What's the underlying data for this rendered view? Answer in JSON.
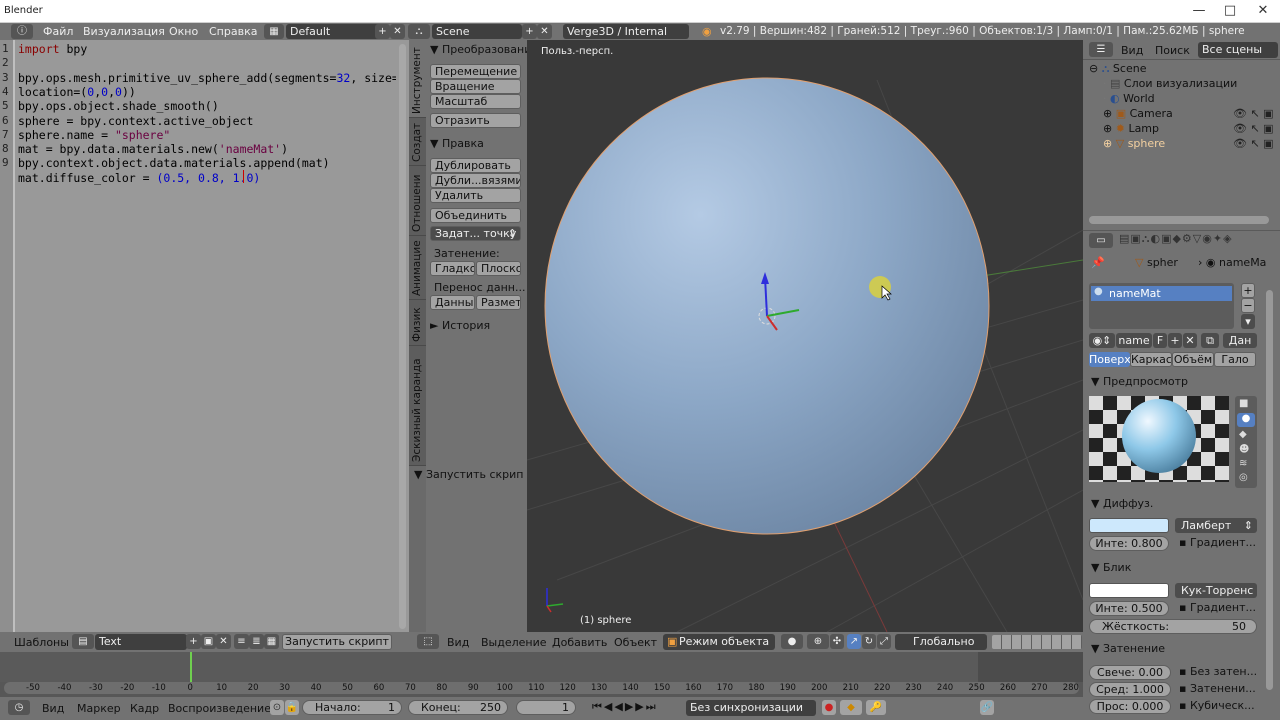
{
  "window": {
    "title": "Blender",
    "controls": [
      "—",
      "□",
      "✕"
    ]
  },
  "info": {
    "menus": [
      "Файл",
      "Визуализация",
      "Окно",
      "Справка"
    ],
    "layout": "Default",
    "scene": "Scene",
    "engine": "Verge3D / Internal",
    "stats": "v2.79 | Вершин:482 | Граней:512 | Треуг.:960 | Объектов:1/3 | Ламп:0/1 | Пам.:25.62МБ | sphere"
  },
  "code": {
    "line_numbers": [
      "1",
      "2",
      "3",
      "4",
      "5",
      "6",
      "7",
      "8",
      "9"
    ],
    "lines": [
      {
        "parts": [
          [
            "kw",
            "import"
          ],
          [
            "t",
            " bpy"
          ]
        ]
      },
      {
        "parts": []
      },
      {
        "parts": [
          [
            "t",
            "bpy.ops.mesh.primitive_uv_sphere_add(segments="
          ],
          [
            "num",
            "32"
          ],
          [
            "t",
            ", size="
          ],
          [
            "num",
            "2"
          ],
          [
            "t",
            ","
          ]
        ]
      },
      {
        "parts": [
          [
            "t",
            "location=("
          ],
          [
            "num",
            "0"
          ],
          [
            "t",
            ","
          ],
          [
            "num",
            "0"
          ],
          [
            "t",
            ","
          ],
          [
            "num",
            "0"
          ],
          [
            "t",
            "))"
          ]
        ]
      },
      {
        "parts": [
          [
            "t",
            "bpy.ops.object.shade_smooth()"
          ]
        ]
      },
      {
        "parts": [
          [
            "t",
            "sphere = bpy.context.active_object"
          ]
        ]
      },
      {
        "parts": [
          [
            "t",
            "sphere.name = "
          ],
          [
            "str",
            "\"sphere\""
          ]
        ]
      },
      {
        "parts": [
          [
            "t",
            "mat = bpy.data.materials.new("
          ],
          [
            "str",
            "'nameMat'"
          ],
          [
            "t",
            ")"
          ]
        ]
      },
      {
        "parts": [
          [
            "t",
            "bpy.context.object.data.materials.append(mat)"
          ]
        ]
      },
      {
        "parts": [
          [
            "t",
            "mat.diffuse_color = "
          ],
          [
            "num",
            "(0.5, 0.8, 1.0)"
          ]
        ]
      }
    ]
  },
  "tool_tabs": [
    "Инструмент",
    "Создат",
    "Отношени",
    "Анимацие",
    "Физик",
    "Эскизный каранда"
  ],
  "toolshelf": {
    "transform_header": "Преобразование",
    "transform_buttons": [
      "Перемещение",
      "Вращение",
      "Масштаб"
    ],
    "mirror": "Отразить",
    "edit_header": "Правка",
    "edit_buttons": [
      "Дублировать",
      "Дубли...вязями",
      "Удалить"
    ],
    "join": "Объединить",
    "origin": "Задат... точку",
    "shading_label": "Затенение:",
    "shading_buttons": [
      "Гладко",
      "Плоско"
    ],
    "data_transfer_label": "Перенос данн...",
    "data_buttons": [
      "Данны",
      "Размет"
    ],
    "history": "История",
    "run_script": "Запустить скрип"
  },
  "viewport": {
    "view_label": "Польз.-персп.",
    "object_label": "(1) sphere",
    "sphere_color": "#8ba8c8"
  },
  "outliner": {
    "menus": [
      "Вид",
      "Поиск"
    ],
    "filter": "Все сцены",
    "items": [
      "Scene",
      "Слои визуализации",
      "World",
      "Camera",
      "Lamp",
      "sphere"
    ]
  },
  "properties": {
    "breadcrumb": [
      "spher",
      "nameMa"
    ],
    "material_slot": "nameMat",
    "material_name": "name",
    "material_f": "F",
    "data_dropdown": "Дан",
    "tabs": [
      "Поверх",
      "Каркас",
      "Объём",
      "Гало"
    ],
    "preview_header": "Предпросмотр",
    "diffuse_header": "Диффуз.",
    "diffuse_color": "#cde8fc",
    "diffuse_shader": "Ламберт",
    "diffuse_intensity": "Инте: 0.800",
    "gradient": "Градиент...",
    "specular_header": "Блик",
    "specular_shader": "Кук-Торренс",
    "specular_intensity": "Инте: 0.500",
    "hardness_label": "Жёсткость:",
    "hardness_value": "50",
    "shading_header": "Затенение",
    "emit": "Свече: 0.00",
    "ambient": "Сред: 1.000",
    "translucency": "Прос: 0.000",
    "shadeless": "Без затен...",
    "tangent": "Затенени...",
    "cubic": "Кубическ..."
  },
  "text_header": {
    "templates": "Шаблоны",
    "textname": "Text",
    "run": "Запустить скрипт"
  },
  "view3d_header": {
    "menus": [
      "Вид",
      "Выделение",
      "Добавить",
      "Объект"
    ],
    "mode": "Режим объекта",
    "orientation": "Глобально"
  },
  "timeline": {
    "ticks": [
      "-50",
      "-40",
      "-30",
      "-20",
      "-10",
      "0",
      "10",
      "20",
      "30",
      "40",
      "50",
      "60",
      "70",
      "80",
      "90",
      "100",
      "110",
      "120",
      "130",
      "140",
      "150",
      "160",
      "170",
      "180",
      "190",
      "200",
      "210",
      "220",
      "230",
      "240",
      "250",
      "260",
      "270",
      "280"
    ],
    "menus": [
      "Вид",
      "Маркер",
      "Кадр",
      "Воспроизведение"
    ],
    "start": "Начало:",
    "start_val": "1",
    "end": "Конец:",
    "end_val": "250",
    "current": "1",
    "sync": "Без синхронизации"
  }
}
